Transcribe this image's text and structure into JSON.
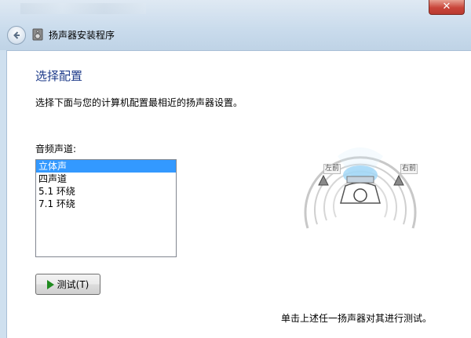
{
  "window": {
    "title": "扬声器安装程序",
    "close_glyph": "✕"
  },
  "page": {
    "heading": "选择配置",
    "description": "选择下面与您的计算机配置最相近的扬声器设置。",
    "channel_label": "音频声道:",
    "channels": [
      {
        "label": "立体声",
        "selected": true
      },
      {
        "label": "四声道",
        "selected": false
      },
      {
        "label": "5.1 环绕",
        "selected": false
      },
      {
        "label": "7.1 环绕",
        "selected": false
      }
    ],
    "test_button": "测试(T)",
    "hint": "单击上述任一扬声器对其进行测试。"
  },
  "diagram": {
    "left_speaker_label": "左前",
    "right_speaker_label": "右前"
  },
  "colors": {
    "heading": "#1e3b8a",
    "selection": "#3399ff",
    "play_icon": "#1f8a1f"
  },
  "icons": [
    "back-arrow-icon",
    "speaker-setup-icon",
    "close-icon",
    "play-icon",
    "speaker-icon",
    "listener-icon"
  ]
}
